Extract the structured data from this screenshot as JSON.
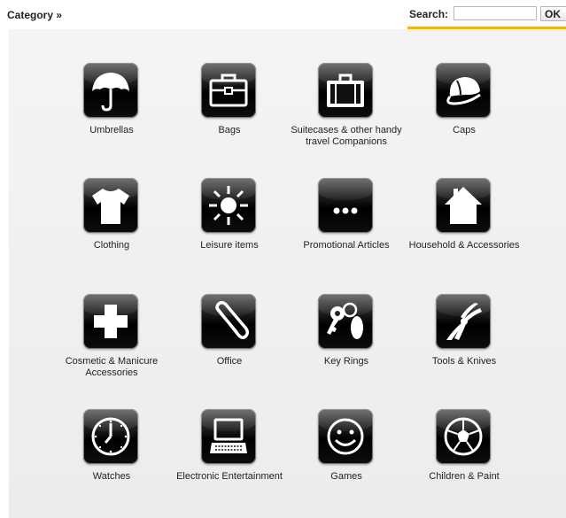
{
  "header": {
    "category_label": "Category »",
    "search_label": "Search:",
    "search_value": "",
    "ok_label": "OK",
    "accent_color": "#f1b31c"
  },
  "categories": [
    {
      "label": "Umbrellas",
      "icon": "umbrella-icon"
    },
    {
      "label": "Bags",
      "icon": "briefcase-icon"
    },
    {
      "label": "Suitecases & other handy travel Companions",
      "icon": "suitcase-icon"
    },
    {
      "label": "Caps",
      "icon": "cap-icon"
    },
    {
      "label": "Clothing",
      "icon": "tshirt-icon"
    },
    {
      "label": "Leisure items",
      "icon": "sun-icon"
    },
    {
      "label": "Promotional Articles",
      "icon": "ellipsis-icon"
    },
    {
      "label": "Household & Accessories",
      "icon": "house-icon"
    },
    {
      "label": "Cosmetic & Manicure Accessories",
      "icon": "cross-icon"
    },
    {
      "label": "Office",
      "icon": "paperclip-icon"
    },
    {
      "label": "Key Rings",
      "icon": "key-ring-icon"
    },
    {
      "label": "Tools & Knives",
      "icon": "pliers-icon"
    },
    {
      "label": "Watches",
      "icon": "clock-icon"
    },
    {
      "label": "Electronic Entertainment",
      "icon": "laptop-icon"
    },
    {
      "label": "Games",
      "icon": "smiley-icon"
    },
    {
      "label": "Children & Paint",
      "icon": "soccer-ball-icon"
    }
  ]
}
